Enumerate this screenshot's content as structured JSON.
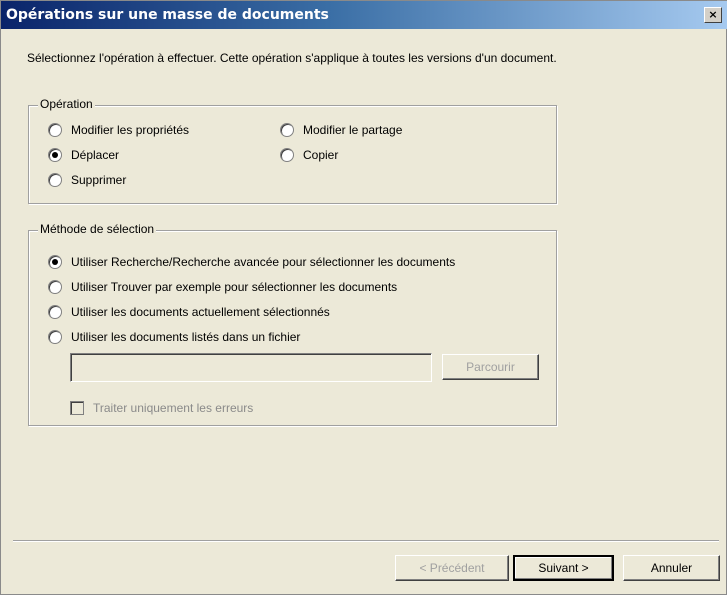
{
  "window": {
    "title": "Opérations sur une masse de documents",
    "close_glyph": "×"
  },
  "intro": "Sélectionnez l'opération à effectuer. Cette opération s'applique à toutes les versions d'un document.",
  "operation_group": {
    "label": "Opération",
    "options": [
      {
        "label": "Modifier les propriétés",
        "checked": false
      },
      {
        "label": "Modifier le partage",
        "checked": false
      },
      {
        "label": "Déplacer",
        "checked": true
      },
      {
        "label": "Copier",
        "checked": false
      },
      {
        "label": "Supprimer",
        "checked": false
      }
    ]
  },
  "selection_group": {
    "label": "Méthode de sélection",
    "options": [
      {
        "label": "Utiliser Recherche/Recherche avancée pour sélectionner les documents",
        "checked": true
      },
      {
        "label": "Utiliser Trouver par exemple pour sélectionner les documents",
        "checked": false
      },
      {
        "label": "Utiliser les documents actuellement sélectionnés",
        "checked": false
      },
      {
        "label": "Utiliser les documents listés dans un fichier",
        "checked": false
      }
    ],
    "file_path_value": "",
    "browse_label": "Parcourir",
    "errors_only_label": "Traiter uniquement les erreurs"
  },
  "footer": {
    "back_label": "< Précédent",
    "next_label": "Suivant >",
    "cancel_label": "Annuler"
  }
}
